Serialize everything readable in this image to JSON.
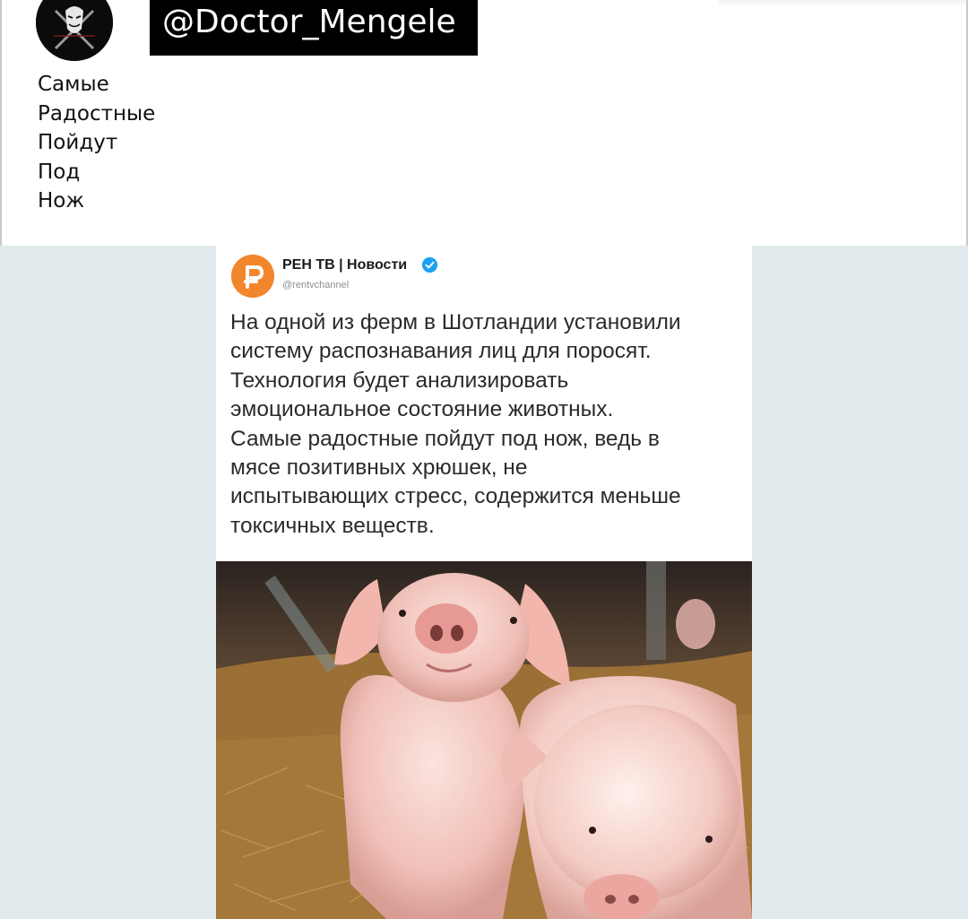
{
  "post": {
    "handle": "@Doctor_Mengele",
    "caption_lines": [
      "Самые",
      "Радостные",
      "Пойдут",
      "Под",
      "Нож"
    ]
  },
  "embedded_tweet": {
    "author_name": "РЕН ТВ | Новости",
    "author_handle": "@rentvchannel",
    "text_lines": [
      "На одной из ферм в Шотландии установили",
      "систему распознавания лиц для поросят.",
      "Технология будет анализировать",
      "эмоциональное состояние животных.",
      "Самые радостные пойдут под нож, ведь в",
      "мясе позитивных хрюшек, не",
      "испытывающих стресс, содержится меньше",
      "токсичных веществ."
    ]
  },
  "colors": {
    "page_background": "#e1eaed",
    "handle_background": "#000000",
    "channel_logo": "#f2862c",
    "verified_badge": "#1da1f2"
  },
  "icons": [
    "guy-fawkes-avatar-icon",
    "ren-tv-logo-icon",
    "verified-badge-icon"
  ]
}
